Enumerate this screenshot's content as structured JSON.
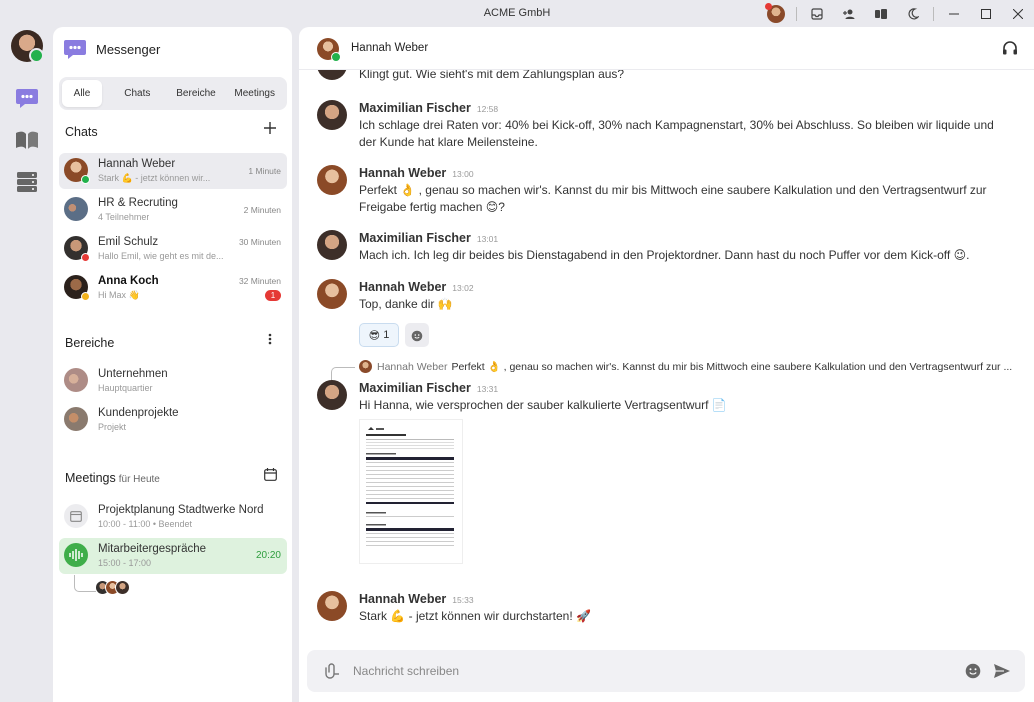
{
  "window": {
    "title": "ACME GmbH"
  },
  "sidebar": {
    "app_name": "Messenger",
    "tabs": [
      {
        "label": "Alle",
        "active": true
      },
      {
        "label": "Chats",
        "active": false
      },
      {
        "label": "Bereiche",
        "active": false
      },
      {
        "label": "Meetings",
        "active": false
      }
    ],
    "chats_title": "Chats",
    "chats": [
      {
        "name": "Hannah Weber",
        "preview": "Stark 💪 - jetzt können wir...",
        "time": "1 Minute",
        "status": "online",
        "unread": null
      },
      {
        "name": "HR & Recruting",
        "preview": "4 Teilnehmer",
        "time": "2 Minuten",
        "status": null,
        "unread": null
      },
      {
        "name": "Emil Schulz",
        "preview": "Hallo Emil, wie geht es mit de...",
        "time": "30 Minuten",
        "status": "busy",
        "unread": null
      },
      {
        "name": "Anna Koch",
        "preview": "Hi Max 👋",
        "time": "32 Minuten",
        "status": "away",
        "unread": "1"
      }
    ],
    "areas_title": "Bereiche",
    "areas": [
      {
        "name": "Unternehmen",
        "sub": "Hauptquartier"
      },
      {
        "name": "Kundenprojekte",
        "sub": "Projekt"
      }
    ],
    "meetings_title": "Meetings",
    "meetings_sub": "für Heute",
    "meetings": [
      {
        "name": "Projektplanung Stadtwerke Nord",
        "sub": "10:00 - 11:00  •  Beendet",
        "live": ""
      },
      {
        "name": "Mitarbeitergespräche",
        "sub": "15:00 - 17:00",
        "live": "20:20"
      }
    ]
  },
  "chat": {
    "partner": "Hannah Weber",
    "messages": [
      {
        "who": "",
        "time": "",
        "text": "Klingt gut. Wie sieht's mit dem Zahlungsplan aus?"
      },
      {
        "who": "Maximilian Fischer",
        "time": "12:58",
        "text": "Ich schlage drei Raten vor: 40% bei Kick-off, 30% nach Kampagnenstart, 30% bei Abschluss. So bleiben wir liquide und der Kunde hat klare Meilensteine."
      },
      {
        "who": "Hannah Weber",
        "time": "13:00",
        "text": "Perfekt 👌 , genau so machen wir's. Kannst du mir bis Mittwoch eine saubere Kalkulation und den Vertragsentwurf zur Freigabe fertig machen 😊?"
      },
      {
        "who": "Maximilian Fischer",
        "time": "13:01",
        "text": "Mach ich. Ich leg dir beides bis Dienstagabend in den Projektordner. Dann hast du noch Puffer vor dem Kick-off 😉."
      },
      {
        "who": "Hannah Weber",
        "time": "13:02",
        "text": "Top, danke dir 🙌"
      },
      {
        "who": "Maximilian Fischer",
        "time": "13:31",
        "text": "Hi Hanna, wie versprochen der sauber kalkulierte Vertragsentwurf 📄"
      },
      {
        "who": "Hannah Weber",
        "time": "15:33",
        "text": "Stark 💪 - jetzt können wir durchstarten! 🚀"
      }
    ],
    "reaction": {
      "emoji": "😎",
      "count": "1"
    },
    "quote": {
      "author": "Hannah Weber",
      "text": "Perfekt 👌 , genau so machen wir's. Kannst du mir bis Mittwoch eine saubere Kalkulation und den Vertragsentwurf zur ..."
    },
    "composer_placeholder": "Nachricht schreiben"
  }
}
